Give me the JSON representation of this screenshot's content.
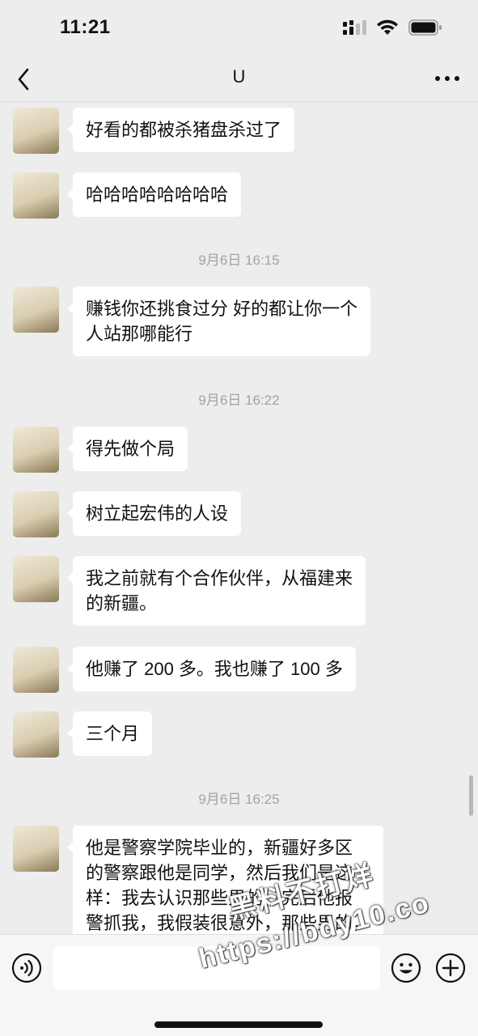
{
  "status_bar": {
    "time": "11:21"
  },
  "nav": {
    "title": "U",
    "back_icon": "chevron-left-icon",
    "more_icon": "ellipsis-icon"
  },
  "messages": [
    {
      "text": "好看的都被杀猪盘杀过了"
    },
    {
      "text": "哈哈哈哈哈哈哈哈"
    },
    {
      "text": "赚钱你还挑食过分 好的都让你一个\n人站那哪能行"
    },
    {
      "text": "得先做个局"
    },
    {
      "text": "树立起宏伟的人设"
    },
    {
      "text": "我之前就有个合作伙伴，从福建来\n的新疆。"
    },
    {
      "text": "他赚了 200 多。我也赚了 100 多"
    },
    {
      "text": "三个月"
    },
    {
      "text": "他是警察学院毕业的，新疆好多区\n的警察跟他是同学，然后我们是这\n样：我去认识那些男的，完后他报\n警抓我，我假装很意外，那些男的，\n朝只得了和你凭的"
    }
  ],
  "timestamps": [
    "9月6日 16:15",
    "9月6日 16:22",
    "9月6日 16:25"
  ],
  "input_bar": {
    "voice_icon": "voice-icon",
    "emoji_icon": "emoji-icon",
    "plus_icon": "plus-icon"
  },
  "watermark": {
    "line1": "黑料不打烊",
    "line2": "https://bdy10.co"
  },
  "colors": {
    "background": "#ededed",
    "bubble": "#ffffff",
    "timestamp": "#a3a3a3"
  }
}
